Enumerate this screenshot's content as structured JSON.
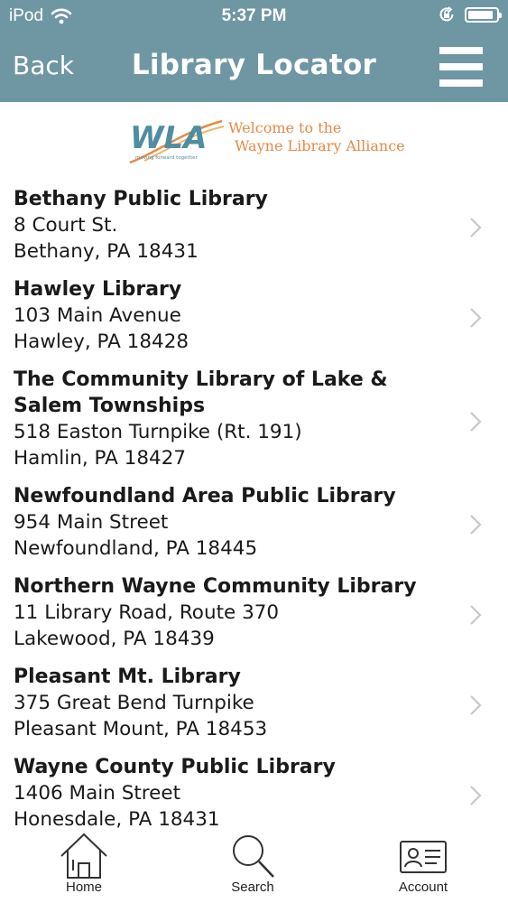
{
  "status": {
    "carrier": "iPod",
    "time": "5:37 PM",
    "battery_level": 0.9
  },
  "nav": {
    "back_label": "Back",
    "title": "Library Locator"
  },
  "logo": {
    "mark_text": "WLA",
    "tagline": "moving forward together",
    "welcome_line1": "Welcome to the",
    "welcome_line2": "Wayne Library Alliance"
  },
  "libraries": [
    {
      "name": "Bethany Public Library",
      "address1": "8 Court St.",
      "address2": "Bethany, PA 18431"
    },
    {
      "name": "Hawley Library",
      "address1": "103 Main Avenue",
      "address2": "Hawley, PA 18428"
    },
    {
      "name": "The Community Library of Lake & Salem Townships",
      "address1": "518 Easton Turnpike (Rt. 191)",
      "address2": "Hamlin, PA 18427"
    },
    {
      "name": "Newfoundland Area Public Library",
      "address1": "954 Main Street",
      "address2": "Newfoundland, PA 18445"
    },
    {
      "name": "Northern Wayne Community Library",
      "address1": "11 Library Road, Route 370",
      "address2": "Lakewood, PA 18439"
    },
    {
      "name": "Pleasant Mt. Library",
      "address1": "375 Great Bend Turnpike",
      "address2": "Pleasant Mount, PA 18453"
    },
    {
      "name": "Wayne County Public Library",
      "address1": "1406 Main Street",
      "address2": "Honesdale, PA 18431"
    }
  ],
  "tabs": {
    "home": "Home",
    "search": "Search",
    "account": "Account"
  },
  "colors": {
    "header": "#6f97a3",
    "logo_orange": "#e58a46",
    "logo_teal": "#4f8da0"
  }
}
